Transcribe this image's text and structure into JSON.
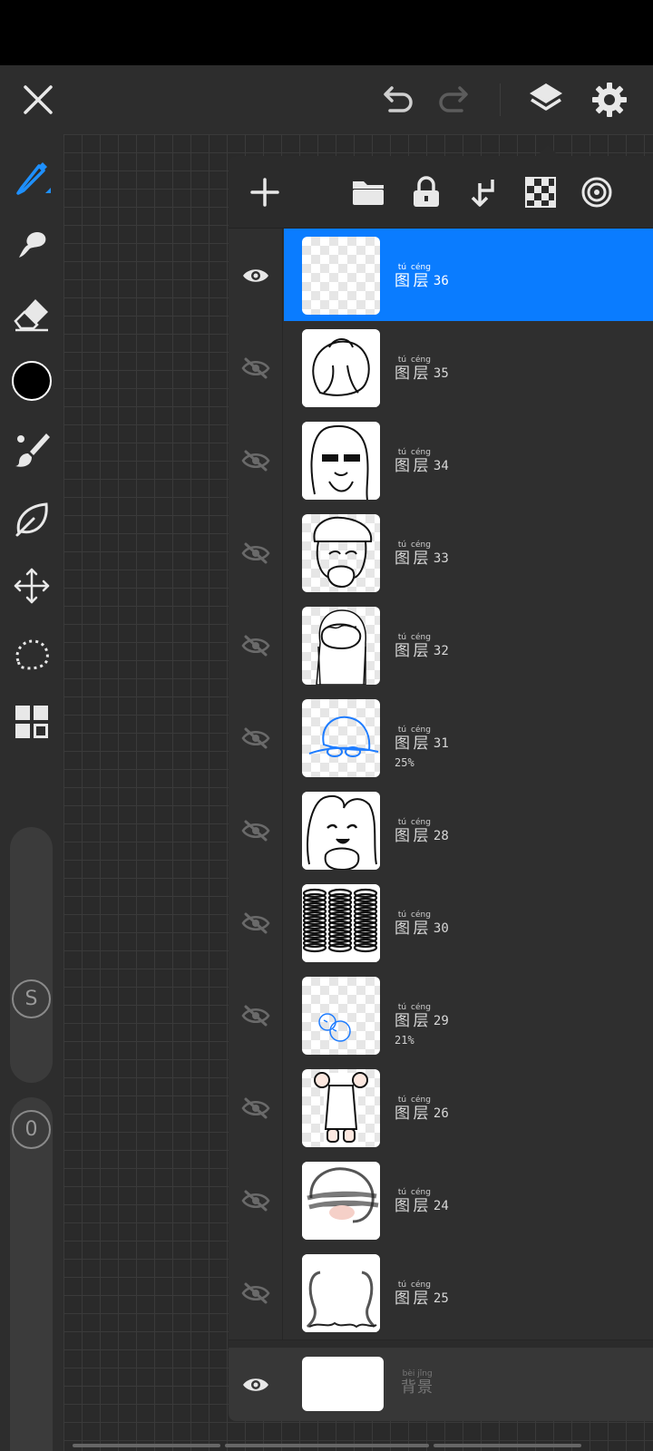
{
  "colors": {
    "accent": "#0a7cff",
    "panel": "#2b2b2b",
    "background": "#2b2b2b",
    "icon": "#e8e8e8",
    "icon_disabled": "#6a6a6a"
  },
  "topbar": {
    "icons": [
      "close-icon",
      "undo-icon",
      "redo-icon",
      "layers-icon",
      "settings-icon"
    ]
  },
  "toolbar": {
    "tools": [
      "pen-icon",
      "smudge-icon",
      "eraser-icon",
      "color-swatch",
      "brush-icon",
      "leaf-icon",
      "move-icon",
      "lasso-icon",
      "grid-icon"
    ],
    "current_color": "#000000",
    "size_label": "S",
    "opacity_label": "0"
  },
  "layers_panel": {
    "tools": [
      "add-layer-icon",
      "folder-icon",
      "lock-icon",
      "merge-down-icon",
      "checker-icon",
      "blend-icon"
    ],
    "layer_prefix": {
      "py1": "tú",
      "hz1": "图",
      "py2": "céng",
      "hz2": "层"
    },
    "layers": [
      {
        "number": "36",
        "visible": true,
        "selected": true,
        "opacity": ""
      },
      {
        "number": "35",
        "visible": false,
        "selected": false,
        "opacity": ""
      },
      {
        "number": "34",
        "visible": false,
        "selected": false,
        "opacity": ""
      },
      {
        "number": "33",
        "visible": false,
        "selected": false,
        "opacity": ""
      },
      {
        "number": "32",
        "visible": false,
        "selected": false,
        "opacity": ""
      },
      {
        "number": "31",
        "visible": false,
        "selected": false,
        "opacity": "25%"
      },
      {
        "number": "28",
        "visible": false,
        "selected": false,
        "opacity": ""
      },
      {
        "number": "30",
        "visible": false,
        "selected": false,
        "opacity": ""
      },
      {
        "number": "29",
        "visible": false,
        "selected": false,
        "opacity": "21%"
      },
      {
        "number": "26",
        "visible": false,
        "selected": false,
        "opacity": ""
      },
      {
        "number": "24",
        "visible": false,
        "selected": false,
        "opacity": ""
      },
      {
        "number": "25",
        "visible": false,
        "selected": false,
        "opacity": ""
      }
    ],
    "background": {
      "py1": "bèi",
      "hz1": "背",
      "py2": "jǐng",
      "hz2": "景",
      "visible": true
    }
  }
}
